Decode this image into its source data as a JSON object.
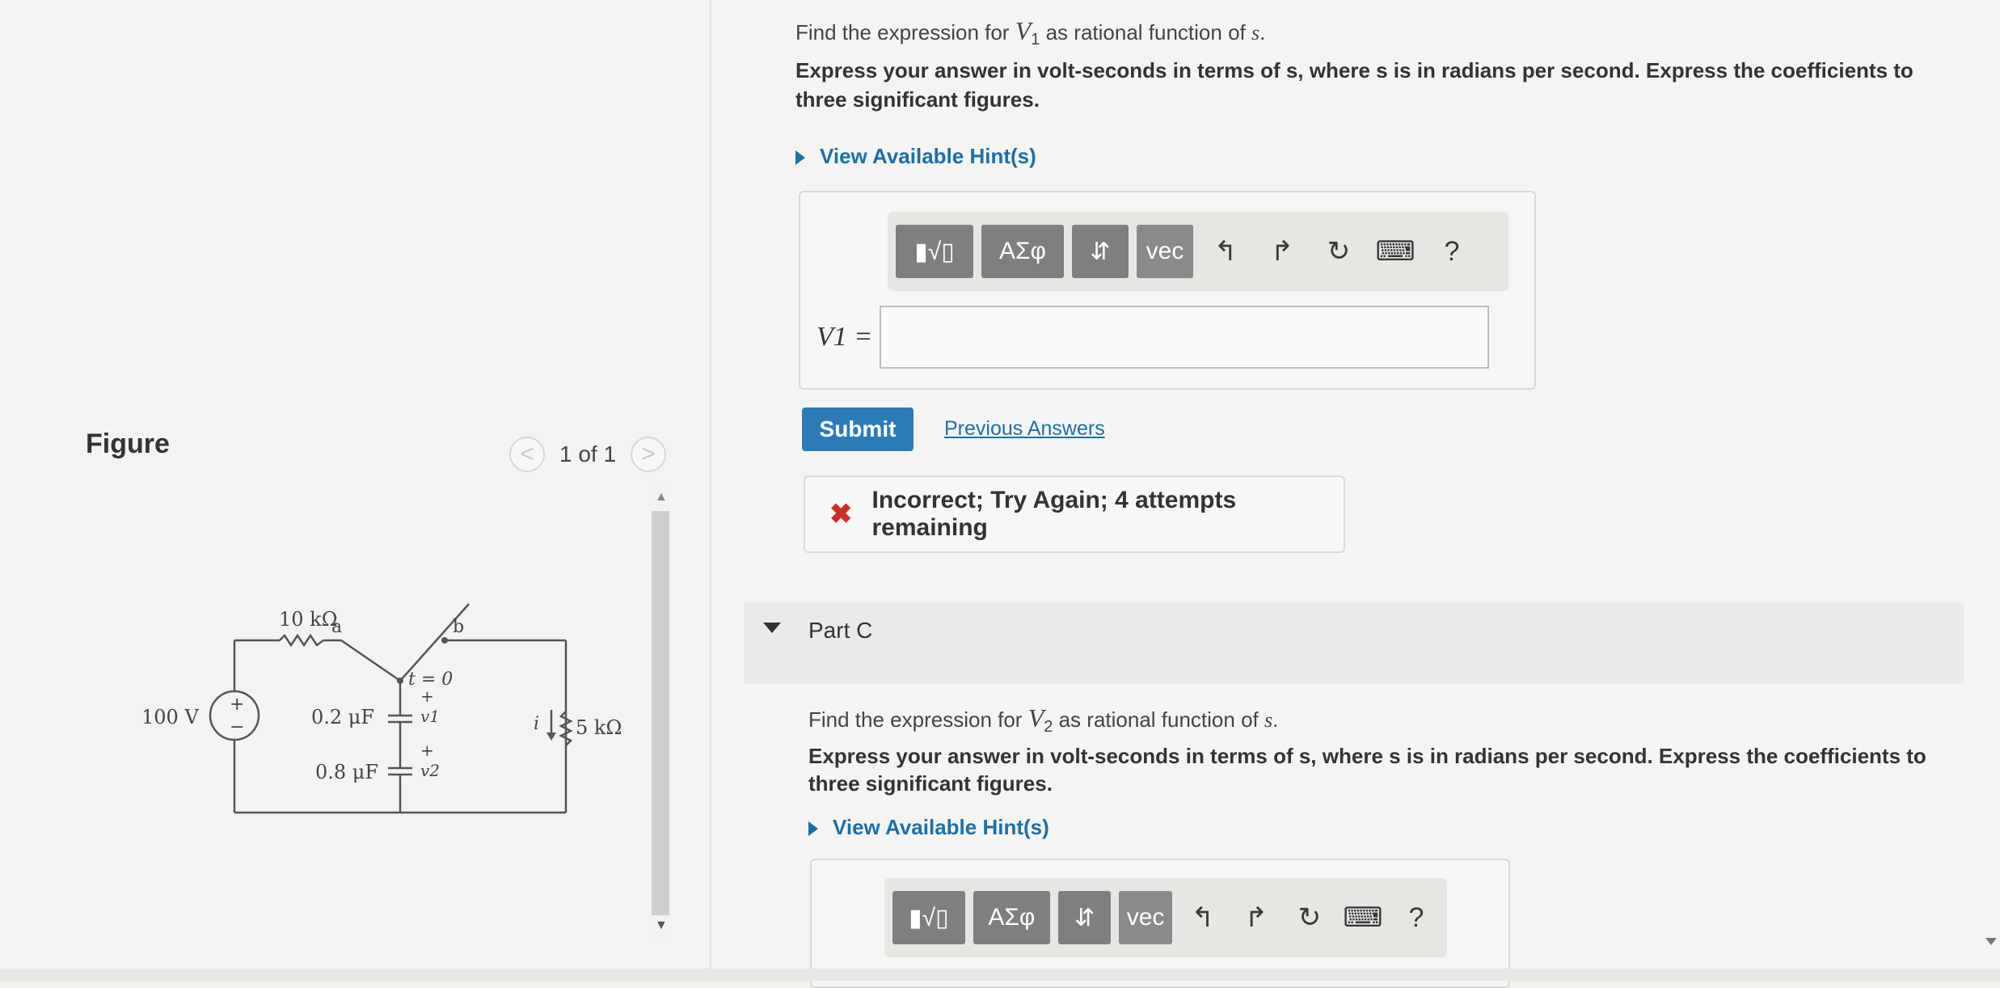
{
  "figure": {
    "title": "Figure",
    "pager_text": "1 of 1",
    "prev_symbol": "<",
    "next_symbol": ">"
  },
  "circuit": {
    "source_label": "100 V",
    "resistor1_label": "10 kΩ",
    "node_a": "a",
    "node_b": "b",
    "switch_label": "t = 0",
    "c1_label": "0.2 μF",
    "c2_label": "0.8 μF",
    "v1_label": "v1",
    "v2_label": "v2",
    "current_label": "i",
    "resistor2_label": "5 kΩ",
    "plus": "+",
    "minus": "−"
  },
  "part_b": {
    "prompt_pre": "Find the expression for ",
    "prompt_var": "V",
    "prompt_sub": "1",
    "prompt_post": " as rational function of ",
    "prompt_s": "s",
    "prompt_end": ".",
    "instructions_line1": "Express your answer in volt-seconds in terms of s, where s is in radians per second. Express the coefficients to",
    "instructions_line2": "three significant figures.",
    "hint_link": "View Available Hint(s)",
    "answer_label": "V1 =",
    "submit_label": "Submit",
    "previous_answers": "Previous Answers",
    "feedback_icon": "✖",
    "feedback": "Incorrect; Try Again; 4 attempts remaining"
  },
  "toolbar": {
    "templates": "▮√▯",
    "greek": "ΑΣφ",
    "arrows": "⇵",
    "vec": "vec",
    "undo": "↰",
    "redo": "↱",
    "reset": "↻",
    "keyboard": "⌨",
    "help": "?"
  },
  "part_c": {
    "label": "Part C",
    "prompt_pre": "Find the expression for ",
    "prompt_var": "V",
    "prompt_sub": "2",
    "prompt_post": " as rational function of ",
    "prompt_s": "s",
    "prompt_end": ".",
    "instructions_line1": "Express your answer in volt-seconds in terms of s, where s is in radians per second. Express the coefficients to",
    "instructions_line2": "three significant figures.",
    "hint_link": "View Available Hint(s)"
  }
}
